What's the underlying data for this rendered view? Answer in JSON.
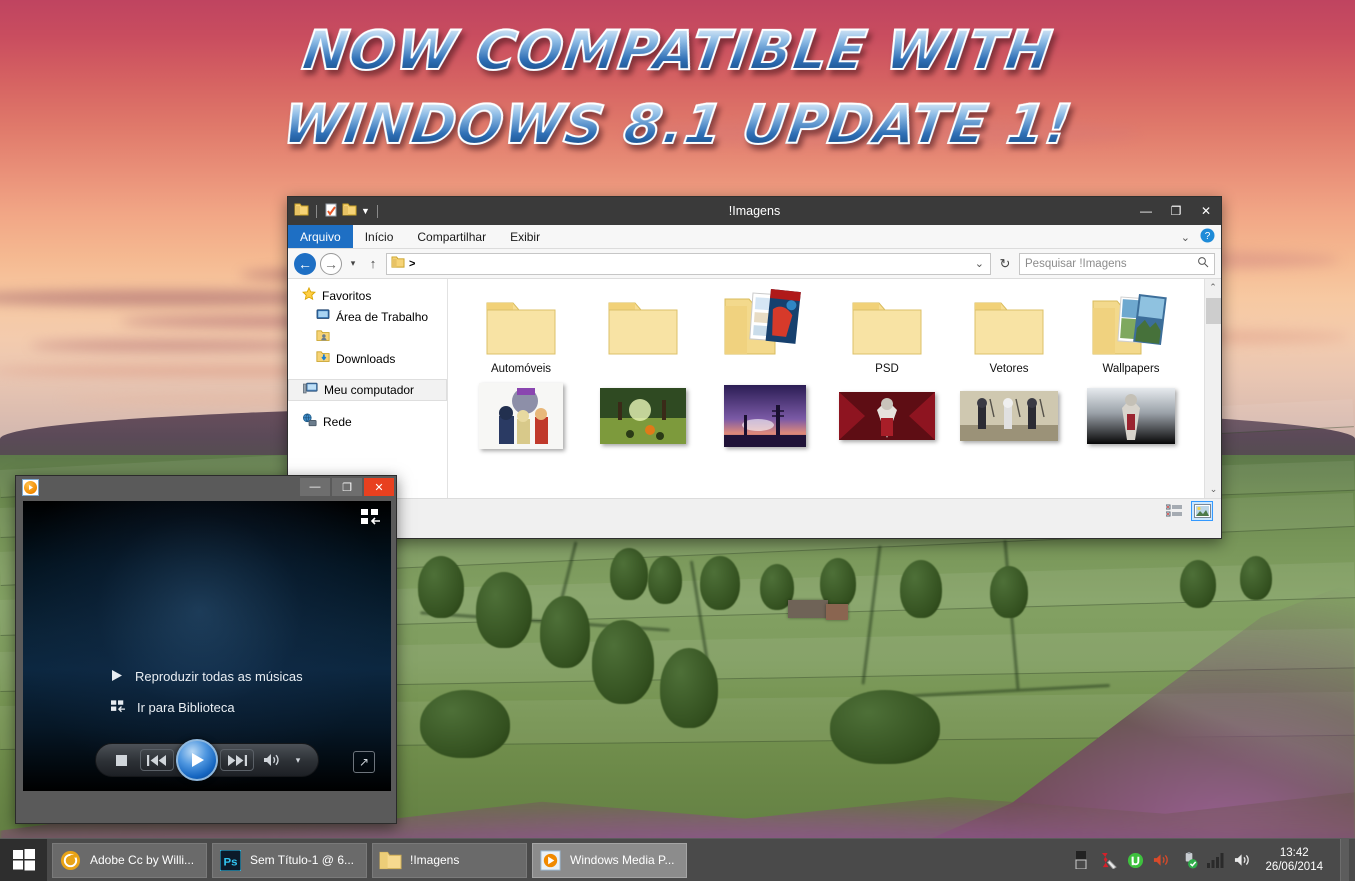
{
  "banner": {
    "line1": "NOW COMPATIBLE WITH",
    "line2": "WINDOWS 8.1 UPDATE 1!"
  },
  "explorer": {
    "title": "!Imagens",
    "quick_access": [
      "folder-icon",
      "properties-icon",
      "new-folder-icon",
      "chevron-down-icon"
    ],
    "window_buttons": {
      "minimize": "—",
      "maximize": "❐",
      "close": "✕"
    },
    "ribbon_tabs": [
      {
        "label": "Arquivo",
        "active": true
      },
      {
        "label": "Início",
        "active": false
      },
      {
        "label": "Compartilhar",
        "active": false
      },
      {
        "label": "Exibir",
        "active": false
      }
    ],
    "ribbon_expand": "⌄",
    "help": "?",
    "address": {
      "back": "←",
      "forward": "→",
      "recent": "▾",
      "up": "↑",
      "path": ">",
      "dropdown": "⌄",
      "refresh": "↻"
    },
    "search": {
      "placeholder": "Pesquisar !Imagens",
      "value": "",
      "icon": "search-icon"
    },
    "nav_pane": [
      {
        "label": "Favoritos",
        "icon": "star-icon",
        "indent": 0,
        "selected": false
      },
      {
        "label": "Área de Trabalho",
        "icon": "desktop-icon",
        "indent": 1,
        "selected": false
      },
      {
        "label": "",
        "icon": "user-folder-icon",
        "indent": 1,
        "selected": false
      },
      {
        "label": "Downloads",
        "icon": "downloads-folder-icon",
        "indent": 1,
        "selected": false
      },
      {
        "label": "Meu computador",
        "icon": "computer-icon",
        "indent": 0,
        "selected": true
      },
      {
        "label": "Rede",
        "icon": "network-icon",
        "indent": 0,
        "selected": false
      }
    ],
    "folders": [
      {
        "label": "Automóveis",
        "type": "folder-plain"
      },
      {
        "label": "",
        "type": "folder-plain"
      },
      {
        "label": "",
        "type": "folder-preview"
      },
      {
        "label": "PSD",
        "type": "folder-plain"
      },
      {
        "label": "Vetores",
        "type": "folder-plain"
      },
      {
        "label": "Wallpapers",
        "type": "folder-preview"
      }
    ],
    "images": [
      {
        "label": "",
        "c1": "#f4f4f2",
        "c2": "#cfd6e6",
        "c3": "#8b5fa8"
      },
      {
        "label": "",
        "c1": "#3e5a2a",
        "c2": "#7d9a3c",
        "c3": "#26361a"
      },
      {
        "label": "",
        "c1": "#2e2150",
        "c2": "#7b5aa6",
        "c3": "#e08a7a"
      },
      {
        "label": "",
        "c1": "#6e0f18",
        "c2": "#b02030",
        "c3": "#2a0408"
      },
      {
        "label": "",
        "c1": "#c9c2ab",
        "c2": "#8d8675",
        "c3": "#3a3730"
      },
      {
        "label": "",
        "c1": "#0a0a0a",
        "c2": "#d8dde2",
        "c3": "#6a6f74"
      }
    ],
    "scrollbar": {
      "up": "⌃",
      "down": "⌄"
    },
    "view_buttons": [
      {
        "name": "details-view",
        "active": false
      },
      {
        "name": "large-icons-view",
        "active": true
      }
    ]
  },
  "media_player": {
    "app_icon": "wmp-play-icon",
    "window_buttons": {
      "minimize": "—",
      "maximize": "❐",
      "close": "✕"
    },
    "switch_library_icon": "switch-to-library-icon",
    "menu": [
      {
        "label": "Reproduzir todas as músicas",
        "icon": "play-icon"
      },
      {
        "label": "Ir para Biblioteca",
        "icon": "library-icon"
      }
    ],
    "controls": {
      "stop": "■",
      "previous": "◀◀",
      "play": "▶",
      "next": "▶▶",
      "volume": "🔊",
      "volume_dropdown": "▾",
      "full_mode": "↗"
    }
  },
  "taskbar": {
    "start": "start-button",
    "items": [
      {
        "label": "Adobe Cc by Willi...",
        "icon": "adobe-cc-icon",
        "active": false
      },
      {
        "label": "Sem Título-1 @ 6...",
        "icon": "photoshop-icon",
        "active": false
      },
      {
        "label": "!Imagens",
        "icon": "folder-icon",
        "active": false
      },
      {
        "label": "Windows Media P...",
        "icon": "wmp-icon",
        "active": true
      }
    ],
    "tray": [
      {
        "name": "show-hidden-icons",
        "glyph": "▮"
      },
      {
        "name": "kaspersky-icon",
        "glyph": "K"
      },
      {
        "name": "utorrent-icon",
        "glyph": "µ"
      },
      {
        "name": "volume-muted-icon",
        "glyph": "🔇"
      },
      {
        "name": "safely-remove-usb-icon",
        "glyph": "⏏"
      },
      {
        "name": "network-signal-icon",
        "glyph": "▁▃▅▇"
      },
      {
        "name": "volume-icon",
        "glyph": "🔊"
      }
    ],
    "clock": {
      "time": "13:42",
      "date": "26/06/2014"
    }
  },
  "colors": {
    "accent_blue": "#1e6fc4",
    "title_bar": "#3a3a3a",
    "taskbar": "#4a4a4a",
    "close_red": "#e8401f",
    "selection_blue": "#cce8ff"
  }
}
